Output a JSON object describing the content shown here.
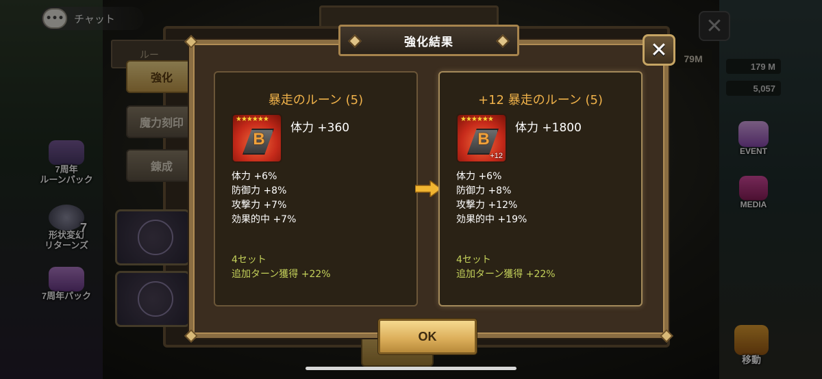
{
  "chat": {
    "label": "チャット",
    "icon": "speech-bubble-icon"
  },
  "background": {
    "side_events": [
      {
        "label": "7周年\nルーンパック"
      },
      {
        "label": "形状変幻\nリターンズ",
        "badge": "7"
      },
      {
        "label": "7周年パック"
      }
    ],
    "right_events": [
      {
        "label": "EVENT"
      },
      {
        "label": "MEDIA"
      },
      {
        "label": "移動"
      }
    ],
    "stats": [
      "179 M",
      "5,057"
    ],
    "under_stat": "79M",
    "tabs": [
      {
        "label": "強化",
        "active": true
      },
      {
        "label": "魔力刻印",
        "active": false
      },
      {
        "label": "錬成",
        "active": false
      }
    ],
    "under_label": "ルー"
  },
  "dialog": {
    "title": "強化結果",
    "close_label": "✕",
    "ok_label": "OK",
    "before": {
      "title": "暴走のルーン (5)",
      "stars": "★★★★★★",
      "rune_letter": "B",
      "level_badge": "",
      "main_stat": "体力 +360",
      "substats": [
        {
          "name": "体力",
          "value": "+6%"
        },
        {
          "name": "防御力",
          "value": "+8%"
        },
        {
          "name": "攻撃力",
          "value": "+7%"
        },
        {
          "name": "効果的中",
          "value": "+7%"
        }
      ],
      "set_name": "4セット",
      "set_effect": "追加ターン獲得 +22%"
    },
    "after": {
      "title": "+12 暴走のルーン (5)",
      "stars": "★★★★★★",
      "rune_letter": "B",
      "level_badge": "+12",
      "main_stat": "体力 +1800",
      "substats": [
        {
          "name": "体力",
          "value": "+6%"
        },
        {
          "name": "防御力",
          "value": "+8%"
        },
        {
          "name": "攻撃力",
          "value": "+12%"
        },
        {
          "name": "効果的中",
          "value": "+19%"
        }
      ],
      "set_name": "4セット",
      "set_effect": "追加ターン獲得 +22%"
    }
  },
  "colors": {
    "card_title": "#f0b24a",
    "set_text": "#c4d15a",
    "arrow": "#f1b531"
  }
}
